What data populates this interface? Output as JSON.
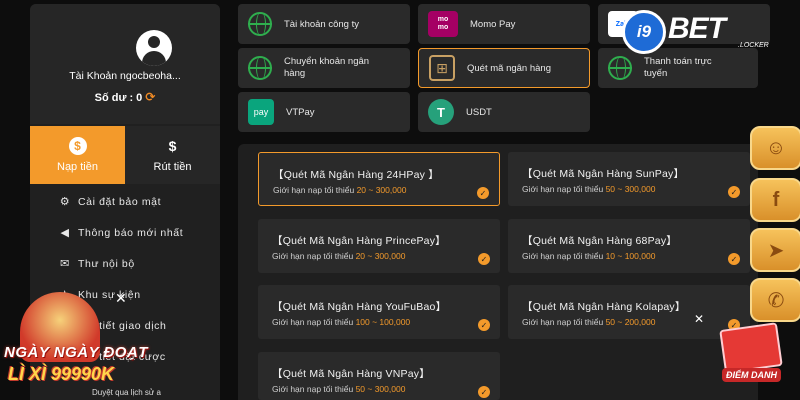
{
  "profile": {
    "account_name": "Tài Khoản ngocbeoha...",
    "balance_label": "Số dư : 0"
  },
  "actions": {
    "deposit": "Nạp tiền",
    "withdraw": "Rút tiền"
  },
  "menu": [
    {
      "label": "Cài đặt bảo mật",
      "icon": "user-gear-icon"
    },
    {
      "label": "Thông báo mới nhất",
      "icon": "megaphone-icon"
    },
    {
      "label": "Thư nội bộ",
      "icon": "mail-icon"
    },
    {
      "label": "Khu sự kiện",
      "icon": "event-icon"
    },
    {
      "label": "Chi tiết giao dịch",
      "icon": "transaction-icon"
    },
    {
      "label": "Chi tiết đặt cược",
      "icon": "bet-icon"
    }
  ],
  "payment_methods": [
    {
      "label": "Tài khoản công ty",
      "icon": "globe-icon"
    },
    {
      "label": "Momo Pay",
      "icon": "momo-icon"
    },
    {
      "label": "Zalo Pay",
      "icon": "zalo-icon"
    },
    {
      "label": "Chuyển khoản ngân hàng",
      "icon": "globe-icon"
    },
    {
      "label": "Quét mã ngân hàng",
      "icon": "qr-icon",
      "selected": true
    },
    {
      "label": "Thanh toán trực tuyến",
      "icon": "globe-icon"
    },
    {
      "label": "VTPay",
      "icon": "vtpay-icon"
    },
    {
      "label": "USDT",
      "icon": "usdt-icon"
    }
  ],
  "banks": [
    {
      "title": "【Quét Mã Ngân Hàng 24HPay 】",
      "limit_prefix": "Giới hạn nạp tối thiểu",
      "range": "20 ~ 300,000",
      "selected": true
    },
    {
      "title": "【Quét Mã Ngân Hàng SunPay】",
      "limit_prefix": "Giới hạn nạp tối thiểu",
      "range": "50 ~ 300,000"
    },
    {
      "title": "【Quét Mã Ngân Hàng PrincePay】",
      "limit_prefix": "Giới hạn nạp tối thiểu",
      "range": "20 ~ 300,000"
    },
    {
      "title": "【Quét Mã Ngân Hàng 68Pay】",
      "limit_prefix": "Giới hạn nạp tối thiểu",
      "range": "10 ~ 100,000"
    },
    {
      "title": "【Quét Mã Ngân Hàng YouFuBao】",
      "limit_prefix": "Giới hạn nạp tối thiểu",
      "range": "100 ~ 100,000"
    },
    {
      "title": "【Quét Mã Ngân Hàng Kolapay】",
      "limit_prefix": "Giới hạn nạp tối thiểu",
      "range": "50 ~ 200,000"
    },
    {
      "title": "【Quét Mã Ngân Hàng VNPay】",
      "limit_prefix": "Giới hạn nạp tối thiểu",
      "range": "50 ~ 300,000"
    }
  ],
  "brand": {
    "mark": "i9",
    "word": "BET",
    "sub": ".LOCKER"
  },
  "promo": {
    "line1": "NGÀY NGÀY ĐOẠT",
    "line2": "LÌ XÌ 99990K",
    "caption": "Duyệt qua lịch sử a",
    "close": "✕"
  },
  "gift": {
    "label": "ĐIỂM DANH",
    "close": "✕"
  },
  "colors": {
    "accent": "#f39a2b",
    "panel": "#2a2a2a",
    "background": "#0d0d0d"
  }
}
